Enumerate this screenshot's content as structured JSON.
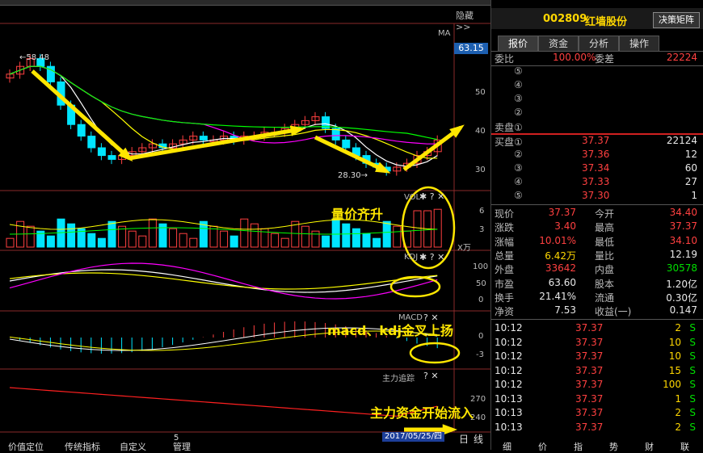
{
  "toolbar": {
    "hide_label": "隐藏"
  },
  "chart": {
    "ma_label": "MA",
    "price_tag": "63.15",
    "high_mark": "58.48",
    "low_mark": "28.30",
    "price_axis": [
      "50",
      "40",
      "30"
    ],
    "vol_label": "VOL",
    "vol_axis": [
      "6",
      "3"
    ],
    "vol_unit": "X万",
    "kdj_label": "KDJ",
    "kdj_axis": [
      "100",
      "50",
      "0"
    ],
    "macd_label": "MACD",
    "macd_axis": [
      "0",
      "-3"
    ],
    "zljz_label": "主力追踪",
    "zljz_axis": [
      "270",
      "240"
    ],
    "x_tick": "5",
    "date_label": "2017/05/25/四",
    "period_day": "日",
    "period_line": "线",
    "annotations": {
      "vol": "量价齐升",
      "macd": "macd、kdj金叉上扬",
      "fund": "主力资金开始流入"
    }
  },
  "bottom_tabs": [
    "价值定位",
    "传统指标",
    "自定义",
    "管理"
  ],
  "panel": {
    "code": "002809",
    "name": "红墙股份",
    "decision_btn": "决策矩阵",
    "tabs": [
      "报价",
      "资金",
      "分析",
      "操作"
    ],
    "ratio_label": "委比",
    "ratio_value": "100.00%",
    "diff_label": "委差",
    "diff_value": "22224",
    "sell_rows": [
      {
        "label": "⑤",
        "price": "",
        "vol": ""
      },
      {
        "label": "④",
        "price": "",
        "vol": ""
      },
      {
        "label": "③",
        "price": "",
        "vol": ""
      },
      {
        "label": "②",
        "price": "",
        "vol": ""
      },
      {
        "label": "卖盘①",
        "price": "",
        "vol": ""
      }
    ],
    "buy_rows": [
      {
        "label": "买盘①",
        "price": "37.37",
        "vol": "22124"
      },
      {
        "label": "②",
        "price": "37.36",
        "vol": "12"
      },
      {
        "label": "③",
        "price": "37.34",
        "vol": "60"
      },
      {
        "label": "④",
        "price": "37.33",
        "vol": "27"
      },
      {
        "label": "⑤",
        "price": "37.30",
        "vol": "1"
      }
    ],
    "stats": [
      {
        "l1": "现价",
        "v1": "37.37",
        "c1": "red",
        "l2": "今开",
        "v2": "34.40",
        "c2": "red"
      },
      {
        "l1": "涨跌",
        "v1": "3.40",
        "c1": "red",
        "l2": "最高",
        "v2": "37.37",
        "c2": "red"
      },
      {
        "l1": "涨幅",
        "v1": "10.01%",
        "c1": "red",
        "l2": "最低",
        "v2": "34.10",
        "c2": "red"
      },
      {
        "l1": "总量",
        "v1": "6.42万",
        "c1": "yellow",
        "l2": "量比",
        "v2": "12.19",
        "c2": "white"
      },
      {
        "l1": "外盘",
        "v1": "33642",
        "c1": "red",
        "l2": "内盘",
        "v2": "30578",
        "c2": "green"
      },
      {
        "l1": "市盈",
        "v1": "63.60",
        "c1": "white",
        "l2": "股本",
        "v2": "1.20亿",
        "c2": "white"
      },
      {
        "l1": "换手",
        "v1": "21.41%",
        "c1": "white",
        "l2": "流通",
        "v2": "0.30亿",
        "c2": "white"
      },
      {
        "l1": "净资",
        "v1": "7.53",
        "c1": "white",
        "l2": "收益(一)",
        "v2": "0.147",
        "c2": "white"
      }
    ],
    "ticks": [
      {
        "t": "10:12",
        "p": "37.37",
        "v": "2",
        "s": "S"
      },
      {
        "t": "10:12",
        "p": "37.37",
        "v": "10",
        "s": "S"
      },
      {
        "t": "10:12",
        "p": "37.37",
        "v": "10",
        "s": "S"
      },
      {
        "t": "10:12",
        "p": "37.37",
        "v": "15",
        "s": "S"
      },
      {
        "t": "10:12",
        "p": "37.37",
        "v": "100",
        "s": "S"
      },
      {
        "t": "10:13",
        "p": "37.37",
        "v": "1",
        "s": "S"
      },
      {
        "t": "10:13",
        "p": "37.37",
        "v": "2",
        "s": "S"
      },
      {
        "t": "10:13",
        "p": "37.37",
        "v": "2",
        "s": "S"
      }
    ],
    "bottom_tabs": [
      "细",
      "价",
      "指",
      "势",
      "财",
      "联"
    ]
  },
  "colors": {
    "up": "#ff4040",
    "down": "#00e5ff",
    "ma5": "#ffffff",
    "ma10": "#ffff00",
    "ma20": "#ff00ff",
    "ma60": "#00ff00",
    "arrow": "#ffe600"
  }
}
